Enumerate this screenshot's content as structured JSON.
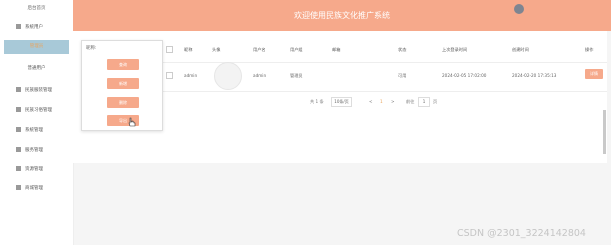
{
  "sidebar": {
    "title": "后台首页",
    "items": [
      {
        "label": "系统用户"
      },
      {
        "label": "管理员"
      },
      {
        "label": "普通用户"
      },
      {
        "label": "民族服装管理"
      },
      {
        "label": "民族习俗管理"
      },
      {
        "label": "系统管理"
      },
      {
        "label": "服务管理"
      },
      {
        "label": "资源管理"
      },
      {
        "label": "商城管理"
      }
    ]
  },
  "header": {
    "title": "欢迎使用民族文化推广系统",
    "avatar_icon": "user-avatar-icon"
  },
  "panel": {
    "label": "昵称:",
    "buttons": [
      {
        "label": "查询"
      },
      {
        "label": "新增"
      },
      {
        "label": "删除"
      },
      {
        "label": "导出"
      }
    ]
  },
  "table": {
    "columns": [
      "昵称",
      "头像",
      "用户名",
      "用户组",
      "邮箱",
      "状态",
      "上次登录时间",
      "创建时间",
      "操作"
    ],
    "rows": [
      {
        "nickname": "admin",
        "username": "admin",
        "group": "管理员",
        "email": "",
        "status": "可用",
        "last_login": "2024-02-05 17:02:00",
        "created": "2024-02-20 17:35:13",
        "action": "详情"
      }
    ]
  },
  "pagination": {
    "total": "共 1 条",
    "page_size": "10条/页",
    "prev": "<",
    "page": "1",
    "next": ">",
    "goto_label": "前往",
    "goto_value": "1",
    "goto_unit": "页"
  },
  "watermark": "CSDN @2301_32241428​04",
  "colors": {
    "accent": "#f6a98b",
    "sidebar_active": "#a8c9d8"
  }
}
